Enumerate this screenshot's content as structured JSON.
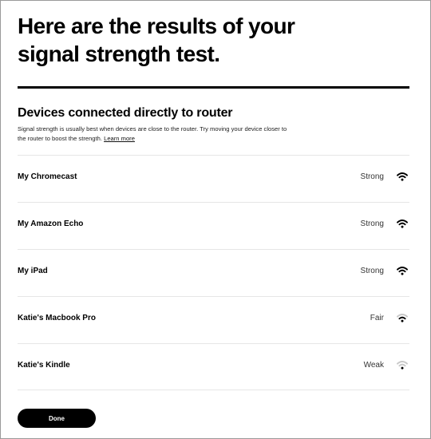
{
  "header": {
    "title": "Here are the results of your signal strength test."
  },
  "section": {
    "title": "Devices connected directly to router",
    "description": "Signal strength is usually best when devices are close to the router. Try moving your device closer to the router to boost the strength.",
    "learn_more": "Learn more"
  },
  "devices": [
    {
      "name": "My Chromecast",
      "status": "Strong",
      "bars": 3,
      "icon": "wifi-strong-icon"
    },
    {
      "name": "My Amazon Echo",
      "status": "Strong",
      "bars": 3,
      "icon": "wifi-strong-icon"
    },
    {
      "name": "My iPad",
      "status": "Strong",
      "bars": 3,
      "icon": "wifi-strong-icon"
    },
    {
      "name": "Katie's Macbook Pro",
      "status": "Fair",
      "bars": 2,
      "icon": "wifi-fair-icon"
    },
    {
      "name": "Katie's Kindle",
      "status": "Weak",
      "bars": 1,
      "icon": "wifi-weak-icon"
    }
  ],
  "actions": {
    "done_label": "Done"
  },
  "colors": {
    "text": "#000000",
    "inactive_bar": "#c8c8c8",
    "button_bg": "#000000",
    "button_text": "#ffffff"
  }
}
